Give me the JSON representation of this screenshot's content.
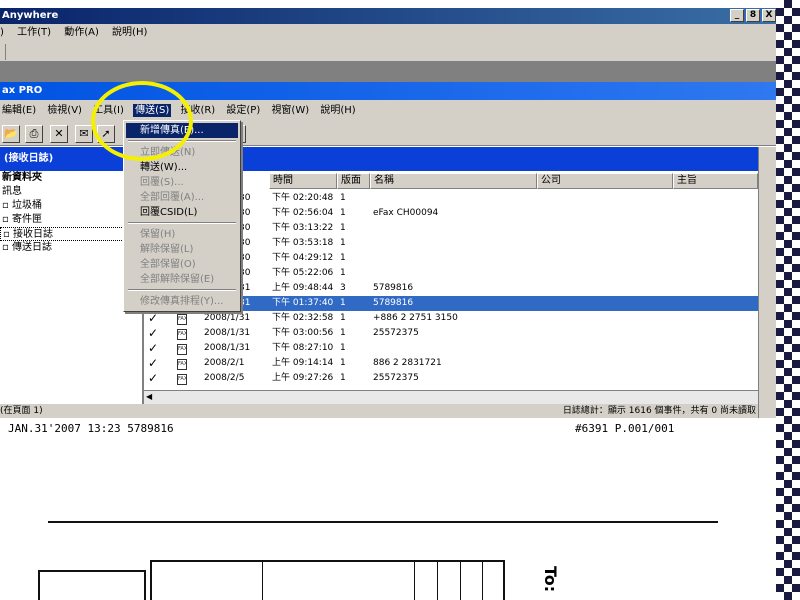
{
  "app": {
    "title": "Anywhere",
    "menu": [
      "工作(T)",
      "動作(A)",
      "說明(H)"
    ],
    "menu_prefix": ")",
    "win_buttons": [
      "_",
      "8",
      "X"
    ]
  },
  "child": {
    "title": "ax PRO",
    "menu": [
      "編輯(E)",
      "檢視(V)",
      "工具(I)",
      "傳送(S)",
      "接收(R)",
      "設定(P)",
      "視窗(W)",
      "說明(H)"
    ]
  },
  "panel": {
    "title": "(接收日誌)"
  },
  "tree": {
    "items": [
      "新資料夾",
      "訊息",
      "垃圾桶",
      "寄件匣",
      "接收日誌",
      "傳送日誌"
    ]
  },
  "list": {
    "columns": [
      "時間",
      "版面",
      "名稱",
      "公司",
      "主旨"
    ],
    "rows": [
      {
        "date": "30",
        "time": "下午 02:20:48",
        "pages": "1",
        "name": ""
      },
      {
        "date": "30",
        "time": "下午 02:56:04",
        "pages": "1",
        "name": "eFax CH00094"
      },
      {
        "date": "30",
        "time": "下午 03:13:22",
        "pages": "1",
        "name": ""
      },
      {
        "date": "30",
        "time": "下午 03:53:18",
        "pages": "1",
        "name": ""
      },
      {
        "date": "30",
        "time": "下午 04:29:12",
        "pages": "1",
        "name": ""
      },
      {
        "date": "30",
        "time": "下午 05:22:06",
        "pages": "1",
        "name": ""
      },
      {
        "date": "31",
        "time": "上午 09:48:44",
        "pages": "3",
        "name": "5789816"
      },
      {
        "date": "31",
        "time": "下午 01:37:40",
        "pages": "1",
        "name": "5789816"
      },
      {
        "date": "2008/1/31",
        "time": "下午 02:32:58",
        "pages": "1",
        "name": "+886 2 2751 3150"
      },
      {
        "date": "2008/1/31",
        "time": "下午 03:00:56",
        "pages": "1",
        "name": "25572375"
      },
      {
        "date": "2008/1/31",
        "time": "下午 08:27:10",
        "pages": "1",
        "name": ""
      },
      {
        "date": "2008/2/1",
        "time": "上午 09:14:14",
        "pages": "1",
        "name": "886 2 2831721"
      },
      {
        "date": "2008/2/5",
        "time": "上午 09:27:26",
        "pages": "1",
        "name": "25572375"
      }
    ],
    "selected_index": 7
  },
  "status": {
    "left": "(在頁面 1)",
    "right": "日誌總計：顯示 1616 個事件，共有 0 尚未讀取"
  },
  "fax": {
    "header_left": "JAN.31'2007 13:23 5789816",
    "header_right": "#6391 P.001/001",
    "to_label": "To:"
  },
  "dropdown": {
    "items": [
      {
        "label": "新增傳真(E)...",
        "state": "highlight"
      },
      {
        "label": "立即傳送(N)",
        "state": "disabled"
      },
      {
        "label": "轉送(W)...",
        "state": "normal"
      },
      {
        "label": "回覆(S)...",
        "state": "disabled"
      },
      {
        "label": "全部回覆(A)...",
        "state": "disabled"
      },
      {
        "label": "回覆CSID(L)",
        "state": "normal"
      },
      {
        "label": "保留(H)",
        "state": "disabled"
      },
      {
        "label": "解除保留(L)",
        "state": "disabled"
      },
      {
        "label": "全部保留(O)",
        "state": "disabled"
      },
      {
        "label": "全部解除保留(E)",
        "state": "disabled"
      },
      {
        "label": "修改傳真排程(Y)...",
        "state": "disabled"
      }
    ]
  },
  "colors": {
    "highlight_circle": "#f5f000",
    "selection": "#316ac5",
    "title_blue": "#0054e3"
  }
}
